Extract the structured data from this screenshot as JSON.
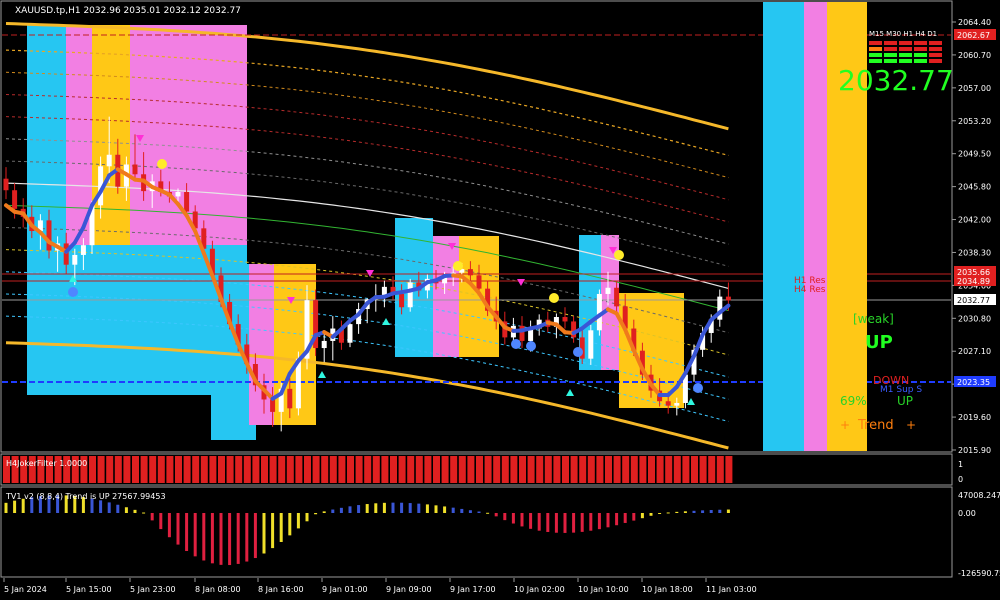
{
  "header": {
    "title": "XAUUSD.tp,H1  2032.96 2035.01 2032.12 2032.77"
  },
  "price_axis": {
    "labels": [
      "2064.40",
      "2060.70",
      "2057.00",
      "2053.20",
      "2049.50",
      "2045.80",
      "2042.00",
      "2038.30",
      "2034.60",
      "2030.80",
      "2027.10",
      "2023.40",
      "2019.60",
      "2015.90"
    ]
  },
  "price_tags": [
    {
      "value": "2062.67",
      "color": "#e02020"
    },
    {
      "value": "2035.66",
      "color": "#e02020"
    },
    {
      "value": "2034.89",
      "color": "#e02020"
    },
    {
      "value": "2032.77",
      "color": "#ffffff"
    },
    {
      "value": "2023.35",
      "color": "#1f3cff"
    }
  ],
  "levels": {
    "h1_res": "H1 Res",
    "h4_res": "H4 Res",
    "pivot_s": "M1 Sup S"
  },
  "dashboard": {
    "timeframes": "M15 M30 H1 H4 D1",
    "current_price": "2032.77",
    "weak": "[weak]",
    "up": "UP",
    "down": "DOWN",
    "percent": "69%",
    "up2": "UP",
    "trend": "Trend",
    "plus1": "+",
    "plus2": "+"
  },
  "sub1": {
    "name": "H4JokerFilter 1.0000",
    "axis": [
      "1",
      "0"
    ]
  },
  "sub2": {
    "name": "TV1 v2 (8,8,4) Trend is UP 27567.99453",
    "axis": [
      "47008.247",
      "0.00",
      "-126590.75"
    ]
  },
  "time_axis": {
    "labels": [
      "5 Jan 2024",
      "5 Jan 15:00",
      "5 Jan 23:00",
      "8 Jan 08:00",
      "8 Jan 16:00",
      "9 Jan 01:00",
      "9 Jan 09:00",
      "9 Jan 17:00",
      "10 Jan 02:00",
      "10 Jan 10:00",
      "10 Jan 18:00",
      "11 Jan 03:00"
    ]
  },
  "chart_data": {
    "type": "candlestick",
    "symbol": "XAUUSD.tp",
    "timeframe": "H1",
    "ylim": [
      2015.9,
      2064.4
    ],
    "candles": [
      [
        2046.5,
        2047.8,
        2044.2,
        2045.2
      ],
      [
        2045.2,
        2046.0,
        2042.0,
        2043.1
      ],
      [
        2043.1,
        2044.3,
        2041.0,
        2042.2
      ],
      [
        2042.2,
        2043.5,
        2039.8,
        2040.6
      ],
      [
        2040.6,
        2042.5,
        2038.5,
        2041.8
      ],
      [
        2041.8,
        2043.0,
        2037.5,
        2038.4
      ],
      [
        2038.4,
        2040.0,
        2036.0,
        2039.2
      ],
      [
        2039.2,
        2040.4,
        2035.8,
        2036.8
      ],
      [
        2036.8,
        2038.6,
        2034.5,
        2037.9
      ],
      [
        2037.9,
        2039.8,
        2036.2,
        2039.0
      ],
      [
        2039.0,
        2044.0,
        2038.0,
        2043.5
      ],
      [
        2043.5,
        2049.0,
        2042.0,
        2047.9
      ],
      [
        2047.9,
        2053.5,
        2046.0,
        2049.2
      ],
      [
        2049.2,
        2051.0,
        2044.8,
        2045.6
      ],
      [
        2045.6,
        2049.0,
        2044.0,
        2048.1
      ],
      [
        2048.1,
        2051.5,
        2046.5,
        2047.0
      ],
      [
        2047.0,
        2049.5,
        2044.0,
        2045.1
      ],
      [
        2045.1,
        2047.0,
        2043.2,
        2046.2
      ],
      [
        2046.2,
        2047.5,
        2044.5,
        2045.0
      ],
      [
        2045.0,
        2046.2,
        2043.8,
        2044.5
      ],
      [
        2044.5,
        2045.4,
        2043.5,
        2045.0
      ],
      [
        2045.0,
        2046.0,
        2042.0,
        2042.8
      ],
      [
        2042.8,
        2043.5,
        2040.2,
        2040.9
      ],
      [
        2040.9,
        2041.8,
        2038.0,
        2038.6
      ],
      [
        2038.6,
        2039.5,
        2035.0,
        2035.6
      ],
      [
        2035.6,
        2036.5,
        2032.0,
        2032.6
      ],
      [
        2032.6,
        2033.5,
        2029.5,
        2030.1
      ],
      [
        2030.1,
        2031.2,
        2027.0,
        2027.8
      ],
      [
        2027.8,
        2029.0,
        2024.5,
        2025.6
      ],
      [
        2025.6,
        2026.8,
        2022.5,
        2023.2
      ],
      [
        2023.2,
        2024.5,
        2020.0,
        2021.6
      ],
      [
        2021.6,
        2023.0,
        2018.5,
        2020.2
      ],
      [
        2020.2,
        2023.5,
        2018.0,
        2022.8
      ],
      [
        2022.8,
        2024.0,
        2019.5,
        2020.6
      ],
      [
        2020.6,
        2027.0,
        2019.8,
        2026.2
      ],
      [
        2026.2,
        2034.5,
        2025.0,
        2032.8
      ],
      [
        2032.8,
        2034.0,
        2026.5,
        2027.4
      ],
      [
        2027.4,
        2029.0,
        2025.8,
        2028.2
      ],
      [
        2028.2,
        2031.0,
        2026.0,
        2029.6
      ],
      [
        2029.6,
        2030.5,
        2027.2,
        2028.0
      ],
      [
        2028.0,
        2030.6,
        2027.5,
        2030.1
      ],
      [
        2030.1,
        2032.5,
        2029.0,
        2031.8
      ],
      [
        2031.8,
        2033.0,
        2030.2,
        2032.9
      ],
      [
        2032.9,
        2034.6,
        2031.5,
        2033.2
      ],
      [
        2033.2,
        2035.0,
        2032.0,
        2034.3
      ],
      [
        2034.3,
        2035.5,
        2032.8,
        2033.5
      ],
      [
        2033.5,
        2034.6,
        2031.2,
        2032.0
      ],
      [
        2032.0,
        2035.2,
        2031.5,
        2034.8
      ],
      [
        2034.8,
        2036.0,
        2033.2,
        2033.9
      ],
      [
        2033.9,
        2035.7,
        2033.0,
        2035.2
      ],
      [
        2035.2,
        2036.2,
        2034.0,
        2034.7
      ],
      [
        2034.7,
        2036.0,
        2033.5,
        2035.5
      ],
      [
        2035.5,
        2036.6,
        2034.4,
        2035.9
      ],
      [
        2035.9,
        2037.0,
        2034.8,
        2036.3
      ],
      [
        2036.3,
        2037.2,
        2035.0,
        2035.6
      ],
      [
        2035.6,
        2036.8,
        2033.5,
        2034.1
      ],
      [
        2034.1,
        2035.0,
        2031.0,
        2031.6
      ],
      [
        2031.6,
        2033.2,
        2029.5,
        2030.4
      ],
      [
        2030.4,
        2031.5,
        2027.8,
        2028.6
      ],
      [
        2028.6,
        2030.8,
        2027.5,
        2029.9
      ],
      [
        2029.9,
        2031.0,
        2027.4,
        2028.2
      ],
      [
        2028.2,
        2030.5,
        2027.0,
        2029.6
      ],
      [
        2029.6,
        2031.2,
        2028.8,
        2030.6
      ],
      [
        2030.6,
        2031.5,
        2029.2,
        2029.8
      ],
      [
        2029.8,
        2031.3,
        2028.5,
        2030.9
      ],
      [
        2030.9,
        2032.0,
        2029.6,
        2030.4
      ],
      [
        2030.4,
        2031.0,
        2028.0,
        2028.6
      ],
      [
        2028.6,
        2029.5,
        2025.6,
        2026.2
      ],
      [
        2026.2,
        2030.0,
        2025.5,
        2029.4
      ],
      [
        2029.4,
        2034.0,
        2028.8,
        2033.5
      ],
      [
        2033.5,
        2036.0,
        2032.2,
        2034.2
      ],
      [
        2034.2,
        2035.0,
        2031.5,
        2032.1
      ],
      [
        2032.1,
        2033.5,
        2029.0,
        2029.6
      ],
      [
        2029.6,
        2030.6,
        2026.5,
        2027.1
      ],
      [
        2027.1,
        2028.0,
        2023.8,
        2024.4
      ],
      [
        2024.4,
        2025.5,
        2021.8,
        2022.6
      ],
      [
        2022.6,
        2024.0,
        2020.8,
        2021.4
      ],
      [
        2021.4,
        2022.5,
        2020.0,
        2020.9
      ],
      [
        2020.9,
        2021.8,
        2019.8,
        2021.2
      ],
      [
        2021.2,
        2025.0,
        2020.6,
        2024.4
      ],
      [
        2024.4,
        2027.8,
        2023.6,
        2027.2
      ],
      [
        2027.2,
        2029.8,
        2026.4,
        2029.1
      ],
      [
        2029.1,
        2031.2,
        2028.0,
        2030.6
      ],
      [
        2030.6,
        2034.0,
        2029.8,
        2033.2
      ],
      [
        2033.2,
        2034.8,
        2031.6,
        2032.77
      ]
    ]
  }
}
